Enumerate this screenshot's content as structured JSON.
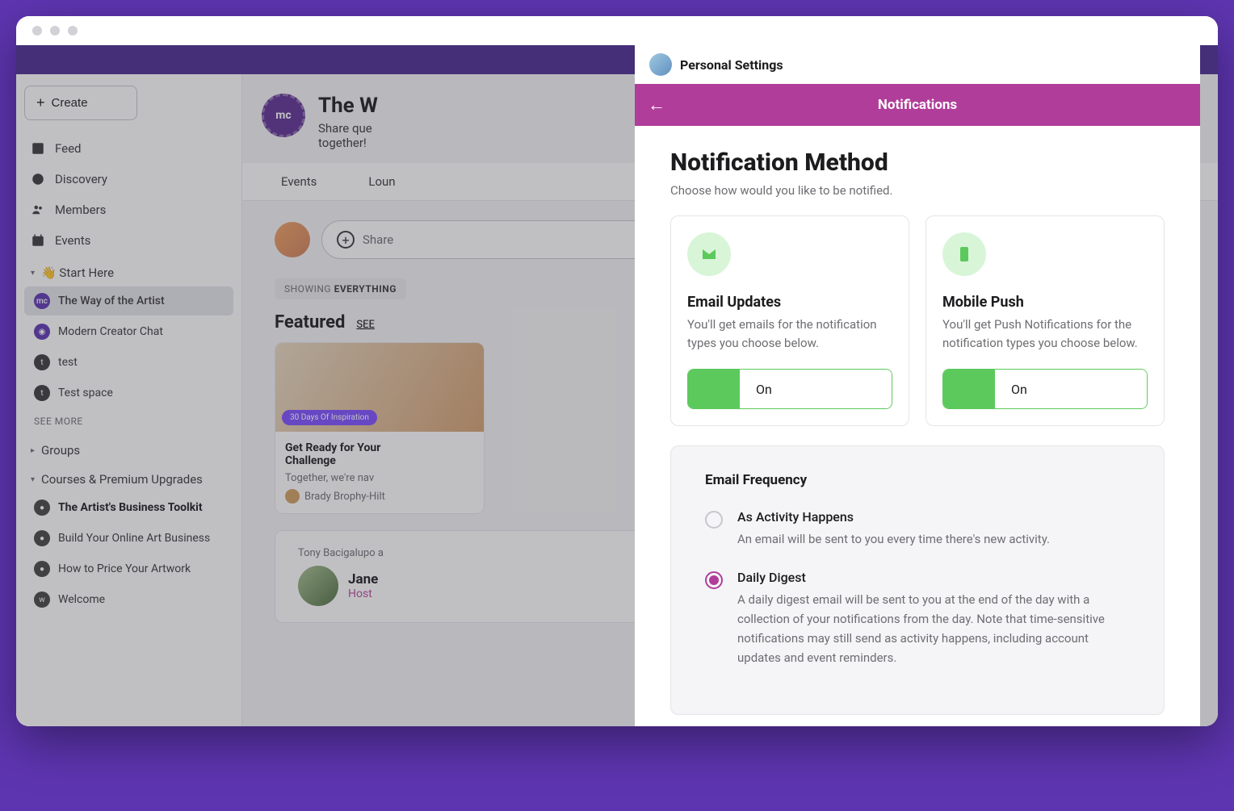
{
  "sidebar": {
    "create_label": "Create",
    "nav": [
      {
        "label": "Feed"
      },
      {
        "label": "Discovery"
      },
      {
        "label": "Members"
      },
      {
        "label": "Events"
      }
    ],
    "start_here": {
      "title": "👋 Start Here",
      "items": [
        {
          "label": "The Way of the Artist",
          "active": true
        },
        {
          "label": "Modern Creator Chat"
        },
        {
          "label": "test"
        },
        {
          "label": "Test space"
        }
      ],
      "see_more": "SEE MORE"
    },
    "groups": {
      "title": "Groups"
    },
    "courses": {
      "title": "Courses & Premium Upgrades",
      "items": [
        {
          "label": "The Artist's Business Toolkit",
          "bold": true
        },
        {
          "label": "Build Your Online Art Business"
        },
        {
          "label": "How to Price Your Artwork"
        },
        {
          "label": "Welcome"
        }
      ]
    }
  },
  "main": {
    "space_title": "The W",
    "space_sub1": "Share que",
    "space_sub2": "together!",
    "tabs": [
      "Events",
      "Loun"
    ],
    "composer_placeholder": "Share",
    "filter_prefix": "SHOWING ",
    "filter_value": "EVERYTHING",
    "featured_title": "Featured",
    "featured_see": "SEE",
    "card": {
      "badge": "30 Days Of Inspiration",
      "title": "Get Ready for Your",
      "title2": "Challenge",
      "desc": "Together, we're nav",
      "author": "Brady Brophy-Hilt"
    },
    "post": {
      "meta": "Tony Bacigalupo a",
      "name": "Jane",
      "host": "Host"
    }
  },
  "panel": {
    "breadcrumb": "Personal Settings",
    "title": "Notifications",
    "section_title": "Notification Method",
    "section_sub": "Choose how would you like to be notified.",
    "methods": [
      {
        "name": "Email Updates",
        "desc": "You'll get emails for the notification types you choose below.",
        "state": "On"
      },
      {
        "name": "Mobile Push",
        "desc": "You'll get Push Notifications for the notification types you choose below.",
        "state": "On"
      }
    ],
    "freq": {
      "title": "Email Frequency",
      "options": [
        {
          "label": "As Activity Happens",
          "desc": "An email will be sent to you every time there's new activity.",
          "selected": false
        },
        {
          "label": "Daily Digest",
          "desc": "A daily digest email will be sent to you at the end of the day with a collection of your notifications from the day. Note that time-sensitive notifications may still send as activity happens, including account updates and event reminders.",
          "selected": true
        }
      ]
    }
  }
}
